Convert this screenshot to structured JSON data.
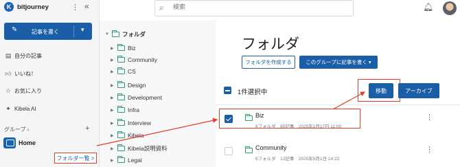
{
  "sidebar": {
    "brand": "bitjourney",
    "write_button": "記事を書く",
    "nav": [
      {
        "icon": "document-icon",
        "label": "自分の記事"
      },
      {
        "icon": "thumbs-up-icon",
        "label": "いいね！"
      },
      {
        "icon": "star-icon",
        "label": "お気に入り"
      },
      {
        "icon": "sparkle-icon",
        "label": "Kibela AI"
      }
    ],
    "group_header": "グループ",
    "home": "Home",
    "folder_list_link": "フォルダ一覧 >"
  },
  "topbar": {
    "search_placeholder": "検索"
  },
  "tree": {
    "root": "フォルダ",
    "items": [
      "Biz",
      "Community",
      "CS",
      "Design",
      "Development",
      "Infra",
      "Interview",
      "Kibela",
      "Kibela説明資料",
      "Legal"
    ]
  },
  "main": {
    "title": "フォルダ",
    "create_folder": "フォルダを作成する",
    "write_to_group": "このグループに記事を書く",
    "selected_text": "1件選択中",
    "move": "移動",
    "archive": "アーカイブ",
    "rows": [
      {
        "name": "Biz",
        "meta": "6フォルダ　65記事　2025年1月17日 11:00",
        "checked": true
      },
      {
        "name": "Community",
        "meta": "6フォルダ　12記事　2025年5月1日 14:22",
        "checked": false
      }
    ]
  },
  "colors": {
    "accent": "#1a5ea8",
    "highlight": "#e53c26",
    "folder": "#2f9e6b"
  }
}
